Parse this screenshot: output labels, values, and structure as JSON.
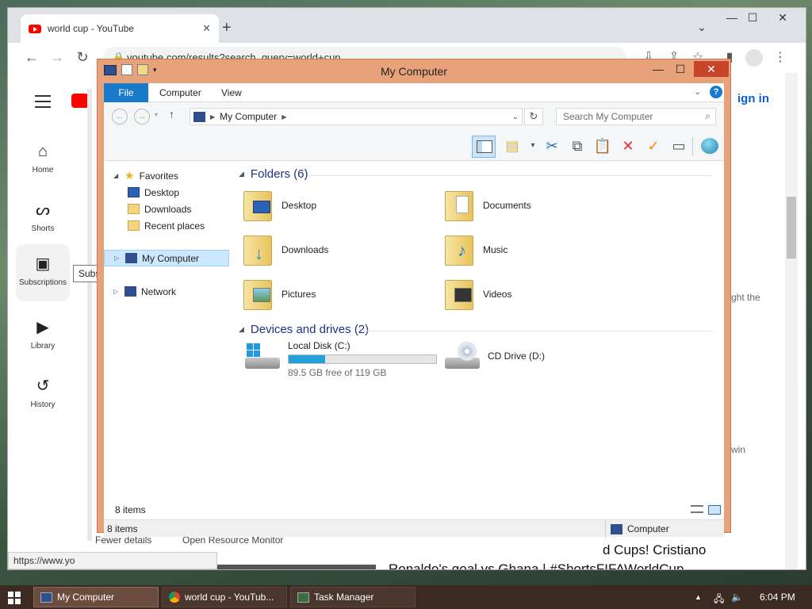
{
  "chrome": {
    "tab_title": "world cup - YouTube",
    "tab_close": "✕",
    "new_tab": "+",
    "tab_list": "⌄",
    "url": "youtube.com/results?search_query=world+cup",
    "status_url": "https://www.yo"
  },
  "youtube": {
    "sidebar": [
      {
        "label": "Home",
        "icon": "⌂"
      },
      {
        "label": "Shorts",
        "icon": "ᔕ"
      },
      {
        "label": "Subscriptions",
        "icon": "▣"
      },
      {
        "label": "Library",
        "icon": "▶"
      },
      {
        "label": "History",
        "icon": "↺"
      }
    ],
    "tooltip": "Subscriptions",
    "sign_in": "ign in",
    "stray_text_1": "ght the",
    "stray_text_2": "win",
    "video_title_line1": "d Cups! Cristiano",
    "video_title_line2": "Ronaldo's goal vs Ghana | #ShortsFIFAWorldCup",
    "behind_power": "Fewer details",
    "behind_monitor": "Open Resource Monitor"
  },
  "explorer": {
    "title": "My Computer",
    "tabs": {
      "file": "File",
      "computer": "Computer",
      "view": "View"
    },
    "address": "My Computer",
    "search_placeholder": "Search My Computer",
    "nav": {
      "favorites": "Favorites",
      "desktop": "Desktop",
      "downloads": "Downloads",
      "recent": "Recent places",
      "my_computer": "My Computer",
      "network": "Network"
    },
    "folders_header": "Folders (6)",
    "folders": [
      {
        "name": "Desktop",
        "overlay": "desktop"
      },
      {
        "name": "Documents",
        "overlay": "documents"
      },
      {
        "name": "Downloads",
        "overlay": "downloads"
      },
      {
        "name": "Music",
        "overlay": "music"
      },
      {
        "name": "Pictures",
        "overlay": "pictures"
      },
      {
        "name": "Videos",
        "overlay": "videos"
      }
    ],
    "devices_header": "Devices and drives (2)",
    "drive_c": {
      "name": "Local Disk (C:)",
      "free": "89.5 GB free of 119 GB",
      "used_fraction": 0.248
    },
    "drive_d": {
      "name": "CD Drive (D:)"
    },
    "items_count": "8 items",
    "status_items": "8 items",
    "status_location": "Computer"
  },
  "taskbar": {
    "items": [
      {
        "label": "My Computer"
      },
      {
        "label": "world cup - YouTub..."
      },
      {
        "label": "Task Manager"
      }
    ],
    "time": "6:04 PM",
    "tray_chevron": "▲",
    "volume_icon": "🔈"
  },
  "colors": {
    "accent": "#1979ca",
    "explorer_border": "#e8a27a",
    "close_red": "#c7442b",
    "capacity": "#26a0da"
  }
}
